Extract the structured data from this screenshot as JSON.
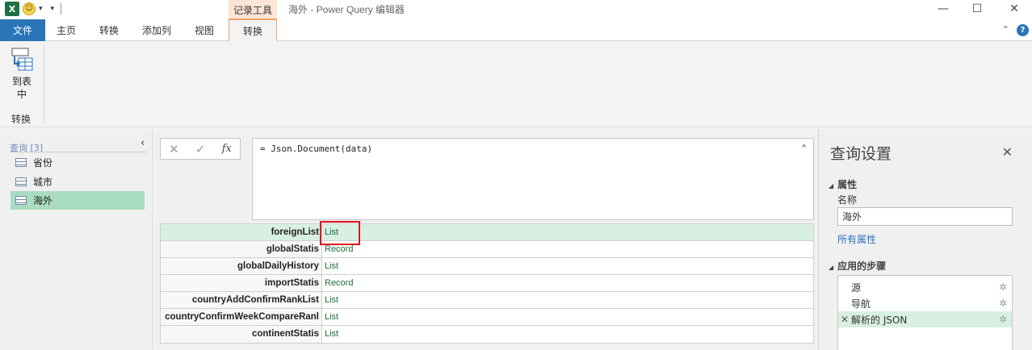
{
  "titlebar": {
    "app_icon": "X",
    "smiley_icon": "☺",
    "qa_dropdown": "▾",
    "contextual_tab": "记录工具",
    "window_title": "海外 - Power Query 编辑器",
    "minimize_glyph": "—",
    "maximize_glyph": "☐",
    "close_glyph": "✕"
  },
  "tabs": {
    "file": "文件",
    "home": "主页",
    "transform": "转换",
    "add_column": "添加列",
    "view": "视图",
    "record_transform": "转换",
    "collapse_glyph": "⌃",
    "help_glyph": "?"
  },
  "ribbon": {
    "to_table_line1": "到表",
    "to_table_line2": "中",
    "group_label": "转换"
  },
  "queries": {
    "header": "查询 [3]",
    "collapse_glyph": "‹",
    "items": [
      {
        "label": "省份"
      },
      {
        "label": "城市"
      },
      {
        "label": "海外"
      }
    ]
  },
  "formula_bar": {
    "cancel_glyph": "✕",
    "commit_glyph": "✓",
    "fx_label": "fx",
    "formula": "= Json.Document(data)",
    "expand_glyph": "⌃"
  },
  "record_rows": [
    {
      "key": "foreignList",
      "value": "List"
    },
    {
      "key": "globalStatis",
      "value": "Record"
    },
    {
      "key": "globalDailyHistory",
      "value": "List"
    },
    {
      "key": "importStatis",
      "value": "Record"
    },
    {
      "key": "countryAddConfirmRankList",
      "value": "List"
    },
    {
      "key": "countryConfirmWeekCompareRanl",
      "value": "List"
    },
    {
      "key": "continentStatis",
      "value": "List"
    }
  ],
  "query_settings": {
    "title": "查询设置",
    "close_glyph": "✕",
    "properties_header": "属性",
    "name_label": "名称",
    "name_value": "海外",
    "all_properties": "所有属性",
    "applied_steps_header": "应用的步骤",
    "steps": [
      {
        "label": "源",
        "delete": ""
      },
      {
        "label": "导航",
        "delete": ""
      },
      {
        "label": "解析的 JSON",
        "delete": "✕"
      }
    ],
    "gear_glyph": "✲"
  }
}
